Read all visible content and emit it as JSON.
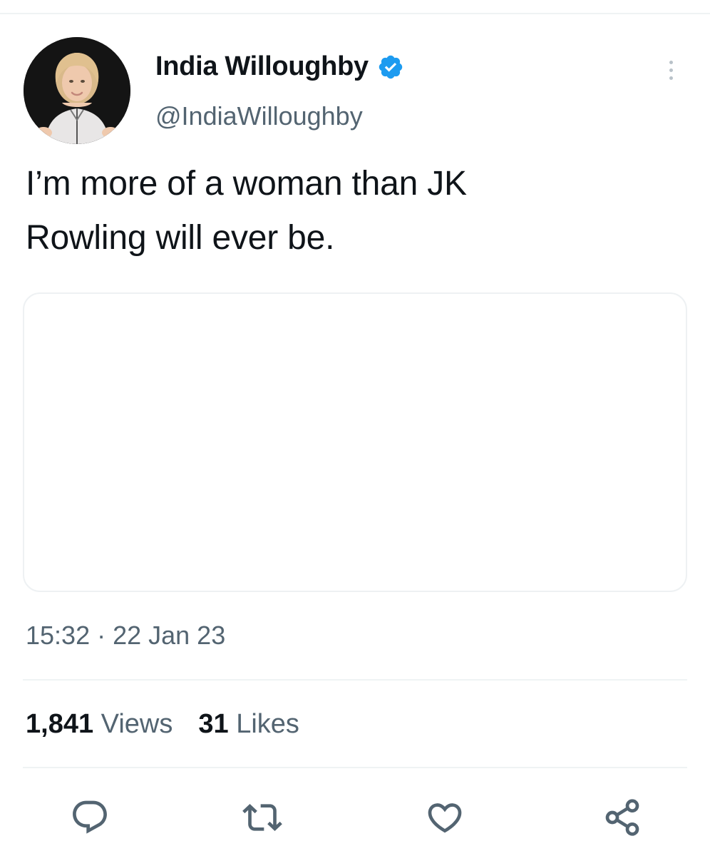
{
  "tweet": {
    "author": {
      "display_name": "India Willoughby",
      "handle": "@IndiaWilloughby",
      "verified": true,
      "verified_color": "#1d9bf0"
    },
    "text_lines": [
      "I’m more of a woman than JK",
      "Rowling will ever be."
    ],
    "timestamp": "15:32 · 22 Jan 23",
    "stats": {
      "views_count": "1,841",
      "views_label": "Views",
      "likes_count": "31",
      "likes_label": "Likes"
    },
    "actions": [
      "reply-icon",
      "retweet-icon",
      "like-icon",
      "share-icon"
    ],
    "colors": {
      "text": "#0f1419",
      "secondary": "#536471",
      "divider": "#eff3f4"
    }
  }
}
